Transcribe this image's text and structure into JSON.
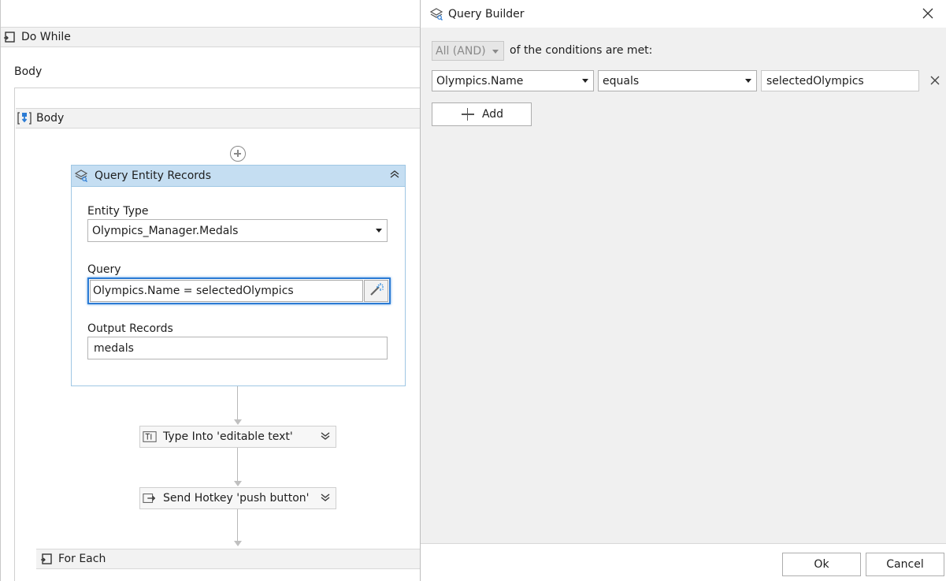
{
  "designer": {
    "do_while": {
      "title": "Do While",
      "icon": "loop-icon"
    },
    "body_label": "Body",
    "body_sequence": {
      "title": "Body",
      "icon": "sequence-icon"
    },
    "query_entity_records": {
      "title": "Query Entity Records",
      "icon": "entity-query-icon",
      "entity_type": {
        "label": "Entity Type",
        "value": "Olympics_Manager.Medals"
      },
      "query": {
        "label": "Query",
        "value": "Olympics.Name = selectedOlympics"
      },
      "output_records": {
        "label": "Output Records",
        "value": "medals"
      }
    },
    "type_into": {
      "title": "Type Into 'editable text'",
      "icon": "type-into-icon"
    },
    "send_hotkey": {
      "title": "Send Hotkey 'push button'",
      "icon": "send-hotkey-icon"
    },
    "for_each": {
      "title": "For Each",
      "icon": "loop-icon"
    }
  },
  "query_builder": {
    "title": "Query Builder",
    "icon": "entity-query-icon",
    "combinator": {
      "value": "All (AND)",
      "enabled": false
    },
    "conditions_text": "of the conditions are met:",
    "condition": {
      "field": "Olympics.Name",
      "operator": "equals",
      "value": "selectedOlympics"
    },
    "add_label": "Add",
    "ok_label": "Ok",
    "cancel_label": "Cancel"
  },
  "colors": {
    "activity_header": "#c5def2",
    "activity_border": "#9fc7e4",
    "focus_border": "#2b7bd4",
    "dialog_background": "#f0f0f0"
  }
}
